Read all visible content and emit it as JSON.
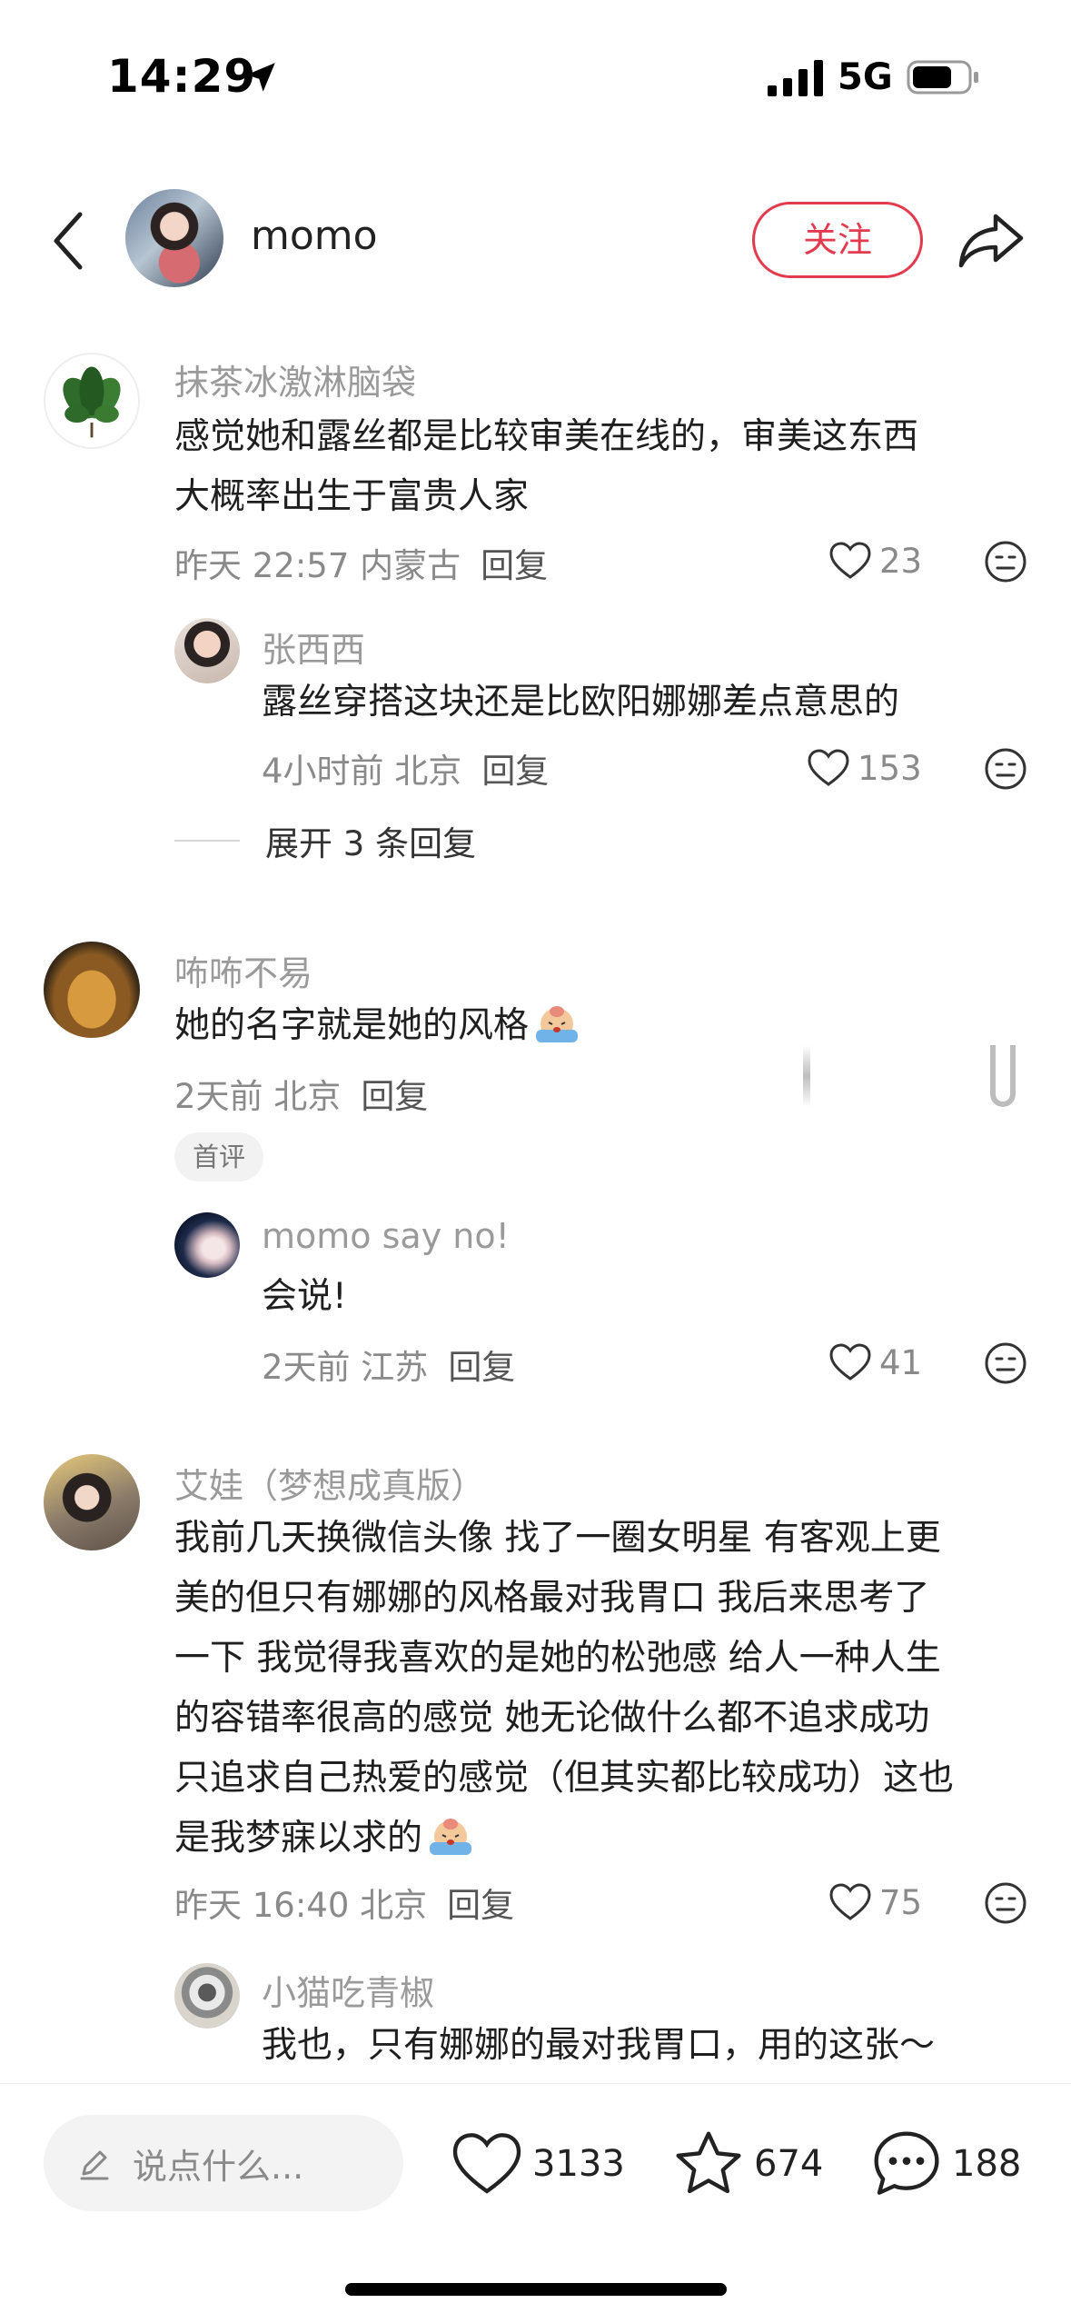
{
  "status": {
    "time": "14:29",
    "network": "5G"
  },
  "header": {
    "author": "momo",
    "follow_label": "关注"
  },
  "comments": [
    {
      "user": "抹茶冰激淋脑袋",
      "lines": [
        "感觉她和露丝都是比较审美在线的，审美这东西",
        "大概率出生于富贵人家"
      ],
      "time_loc": "昨天 22:57 内蒙古",
      "reply_label": "回复",
      "likes": "23",
      "sub": {
        "user": "张西西",
        "text": "露丝穿搭这块还是比欧阳娜娜差点意思的",
        "time_loc": "4小时前 北京",
        "reply_label": "回复",
        "likes": "153"
      },
      "expand_label": "展开 3 条回复"
    },
    {
      "user": "咘咘不易",
      "text": "她的名字就是她的风格",
      "time_loc": "2天前 北京",
      "reply_label": "回复",
      "tag": "首评",
      "sub": {
        "user": "momo say no!",
        "text": "会说!",
        "time_loc": "2天前 江苏",
        "reply_label": "回复",
        "likes": "41"
      }
    },
    {
      "user": "艾娃（梦想成真版）",
      "lines": [
        "我前几天换微信头像 找了一圈女明星 有客观上更",
        "美的但只有娜娜的风格最对我胃口 我后来思考了",
        "一下 我觉得我喜欢的是她的松弛感 给人一种人生",
        "的容错率很高的感觉 她无论做什么都不追求成功",
        "只追求自己热爱的感觉（但其实都比较成功）这也",
        "是我梦寐以求的"
      ],
      "time_loc": "昨天 16:40 北京",
      "reply_label": "回复",
      "likes": "75",
      "sub": {
        "user": "小猫吃青椒",
        "text": "我也，只有娜娜的最对我胃口，用的这张～"
      }
    }
  ],
  "bottom": {
    "input_placeholder": "说点什么...",
    "likes": "3133",
    "favorites": "674",
    "comments": "188"
  }
}
